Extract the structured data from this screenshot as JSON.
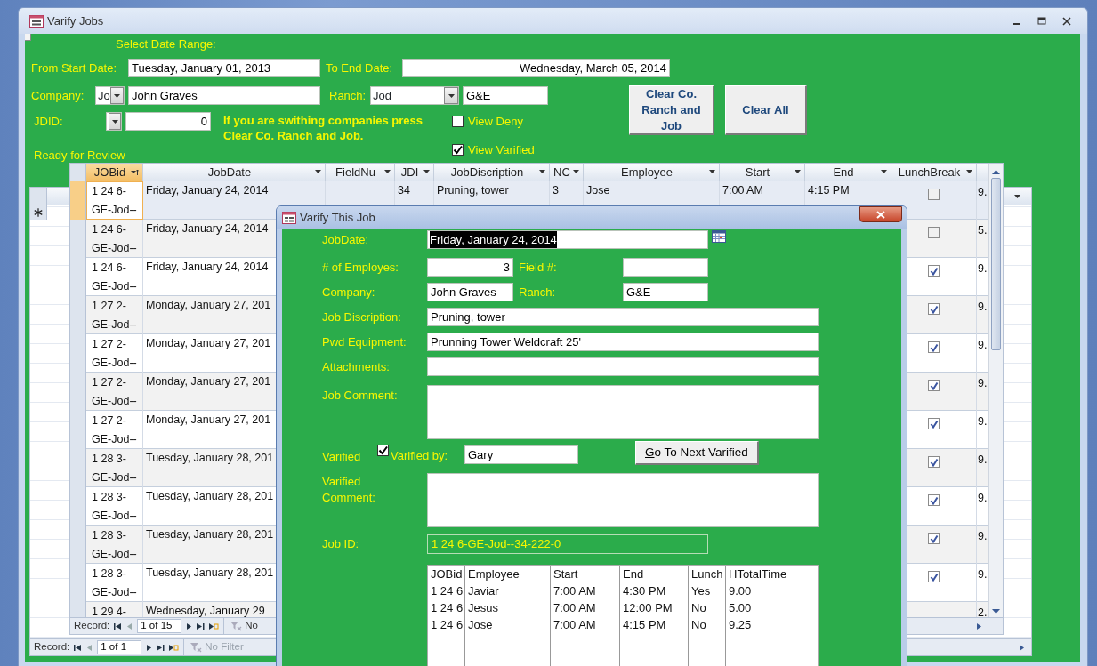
{
  "window": {
    "title": "Varify Jobs"
  },
  "filters": {
    "section_label": "Select Date Range:",
    "start_label": "From Start Date:",
    "start_value": "Tuesday, January 01, 2013",
    "end_label": "To End Date:",
    "end_value": "Wednesday, March 05, 2014",
    "company_label": "Company:",
    "company_code": "Jo",
    "company_name": "John Graves",
    "ranch_label": "Ranch:",
    "ranch_code": "Jod",
    "ranch_name": "G&E",
    "jdid_label": "JDID:",
    "jdid_value": "0",
    "hint": "If you are swithing companies press Clear Co. Ranch and Job.",
    "options": [
      {
        "label": "View Deny",
        "checked": false
      },
      {
        "label": "View Varified",
        "checked": true
      }
    ],
    "buttons": [
      "Clear Co. Ranch and Job",
      "Clear All"
    ]
  },
  "list_label": "Ready for Review",
  "grid": {
    "columns": [
      {
        "label": "JOBid",
        "sorted": true
      },
      {
        "label": "JobDate",
        "sorted": false
      },
      {
        "label": "FieldNu",
        "sorted": false
      },
      {
        "label": "JDI",
        "sorted": false
      },
      {
        "label": "JobDiscription",
        "sorted": false
      },
      {
        "label": "NC",
        "sorted": false
      },
      {
        "label": "Employee",
        "sorted": false
      },
      {
        "label": "Start",
        "sorted": false
      },
      {
        "label": "End",
        "sorted": false
      },
      {
        "label": "LunchBreak",
        "sorted": false
      }
    ],
    "rows": [
      {
        "selected": true,
        "jobid": "1 24 6-GE-Jod--",
        "jobdate": "Friday, January 24, 2014",
        "jdid": "34",
        "description": "Pruning, tower",
        "nc": "3",
        "employee": "Jose",
        "start": "7:00 AM",
        "end": "4:15 PM",
        "lunch_break": false,
        "column_11": "9."
      },
      {
        "selected": false,
        "jobid": "1 24 6-GE-Jod--",
        "jobdate": "Friday, January 24, 2014",
        "lunch_break": false,
        "column_11": "5."
      },
      {
        "selected": false,
        "jobid": "1 24 6-GE-Jod--",
        "jobdate": "Friday, January 24, 2014",
        "lunch_break": true,
        "column_11": "9."
      },
      {
        "selected": false,
        "jobid": "1 27 2-GE-Jod--",
        "jobdate": "Monday, January 27, 201",
        "lunch_break": true,
        "column_11": "9."
      },
      {
        "selected": false,
        "jobid": "1 27 2-GE-Jod--",
        "jobdate": "Monday, January 27, 201",
        "lunch_break": true,
        "column_11": "9."
      },
      {
        "selected": false,
        "jobid": "1 27 2-GE-Jod--",
        "jobdate": "Monday, January 27, 201",
        "lunch_break": true,
        "column_11": "9."
      },
      {
        "selected": false,
        "jobid": "1 27 2-GE-Jod--",
        "jobdate": "Monday, January 27, 201",
        "lunch_break": true,
        "column_11": "9."
      },
      {
        "selected": false,
        "jobid": "1 28 3-GE-Jod--",
        "jobdate": "Tuesday, January 28, 201",
        "lunch_break": true,
        "column_11": "9."
      },
      {
        "selected": false,
        "jobid": "1 28 3-GE-Jod--",
        "jobdate": "Tuesday, January 28, 201",
        "lunch_break": true,
        "column_11": "9."
      },
      {
        "selected": false,
        "jobid": "1 28 3-GE-Jod--",
        "jobdate": "Tuesday, January 28, 201",
        "lunch_break": true,
        "column_11": "9."
      },
      {
        "selected": false,
        "jobid": "1 28 3-GE-Jod--",
        "jobdate": "Tuesday, January 28, 201",
        "lunch_break": true,
        "column_11": "9."
      },
      {
        "selected": false,
        "jobid": "1 29 4-",
        "jobdate": "Wednesday, January 29",
        "column_11": "2."
      }
    ],
    "record_nav": {
      "label": "Record:",
      "position": "1 of 15",
      "filter": "No"
    }
  },
  "back_nav": {
    "label": "Record:",
    "position": "1 of 1",
    "filter": "No Filter",
    "filter_disabled": true
  },
  "dialog": {
    "title": "Varify This Job",
    "job_date_label": "JobDate:",
    "job_date": "Friday, January 24, 2014",
    "job_date_selected": true,
    "employees_label": "# of Employes:",
    "employees": "3",
    "field_label": "Field #:",
    "company_label": "Company:",
    "company": "John Graves",
    "ranch_label": "Ranch:",
    "ranch": "G&E",
    "description_label": "Job Discription:",
    "description": "Pruning, tower",
    "equipment_label": "Pwd Equipment:",
    "equipment": "Prunning Tower Weldcraft 25'",
    "attachments_label": "Attachments:",
    "comment_label": "Job Comment:",
    "varified_label": "Varified",
    "varified": true,
    "varified_by_label": "Varified by:",
    "varified_by": "Gary",
    "next_button": "Go To Next Varified",
    "varified_comment_label": "Varified Comment:",
    "job_id_label": "Job ID:",
    "job_id": "1 24 6-GE-Jod--34-222-0",
    "employees_table": {
      "columns": [
        "JOBid",
        "Employee",
        "Start",
        "End",
        "Lunch",
        "HTotalTime"
      ],
      "rows": [
        [
          "1 24 6",
          "Javiar",
          "7:00 AM",
          "4:30 PM",
          "Yes",
          "9.00"
        ],
        [
          "1 24 6",
          "Jesus",
          "7:00 AM",
          "12:00 PM",
          "No",
          "5.00"
        ],
        [
          "1 24 6",
          "Jose",
          "7:00 AM",
          "4:15 PM",
          "No",
          "9.25"
        ]
      ]
    }
  }
}
